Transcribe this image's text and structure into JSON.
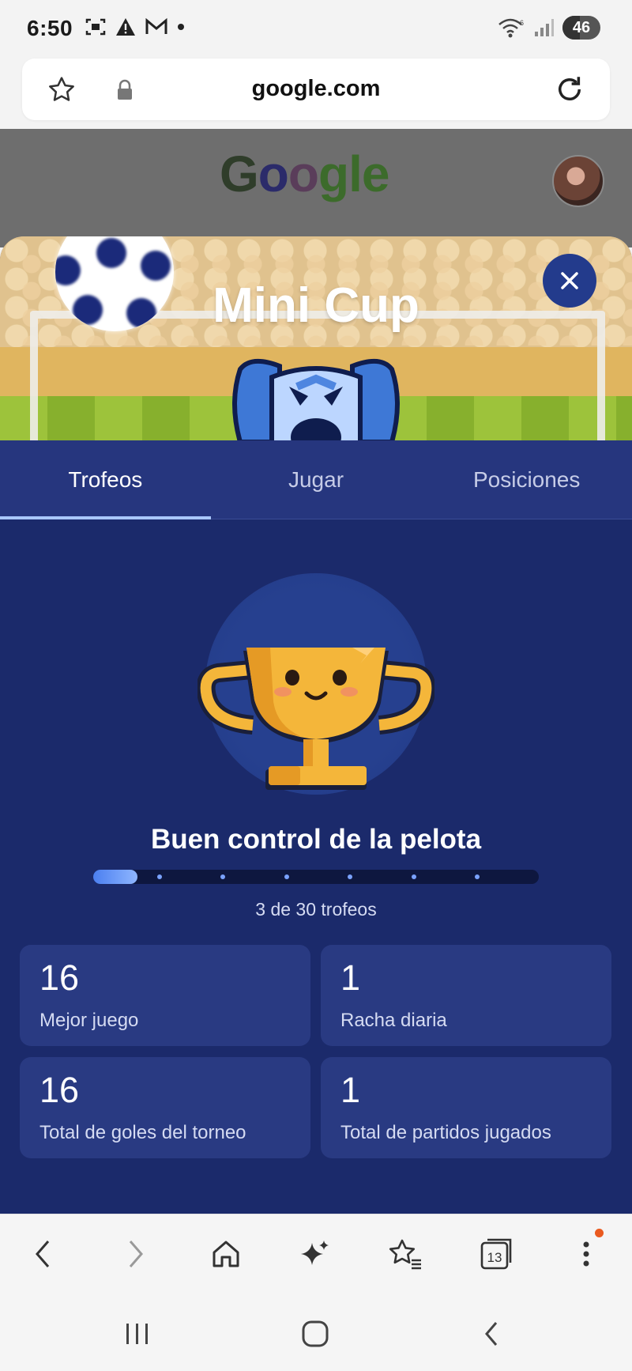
{
  "status_bar": {
    "time": "6:50",
    "battery": "46",
    "battery_level": 0.46
  },
  "browser": {
    "url": "google.com"
  },
  "google_header": {
    "logo_text": "Google"
  },
  "doodle": {
    "title": "Mini Cup",
    "tabs": [
      {
        "label": "Trofeos",
        "active": true
      },
      {
        "label": "Jugar",
        "active": false
      },
      {
        "label": "Posiciones",
        "active": false
      }
    ],
    "trophy_name": "Buen control de la pelota",
    "progress": {
      "current": 3,
      "total": 30,
      "fraction": 0.1,
      "text": "3 de 30 trofeos"
    },
    "stats": [
      {
        "value": "16",
        "label": "Mejor juego"
      },
      {
        "value": "1",
        "label": "Racha diaria"
      },
      {
        "value": "16",
        "label": "Total de goles del torneo"
      },
      {
        "value": "1",
        "label": "Total de partidos jugados"
      }
    ]
  },
  "bottom_nav": {
    "tabs_count": "13",
    "items": [
      "back-icon",
      "forward-icon",
      "home-icon",
      "sparkle-icon",
      "bookmarks-icon",
      "tabs-icon",
      "more-icon"
    ]
  },
  "colors": {
    "sheet_bg": "#1b2a6b",
    "tabs_bg": "#26367e",
    "card_bg": "#293a82",
    "active_tab_indicator": "#a9c7ff",
    "trophy_gold": "#f4b63a",
    "notification_dot": "#ea5a1f"
  }
}
